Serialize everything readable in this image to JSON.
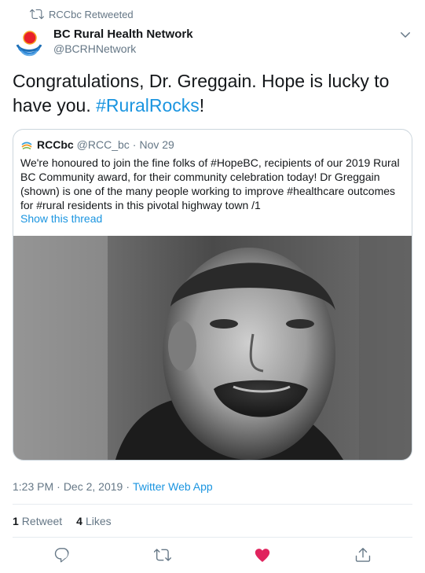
{
  "retweet_context": {
    "text": "RCCbc Retweeted"
  },
  "author": {
    "name": "BC Rural Health Network",
    "handle": "@BCRHNetwork"
  },
  "tweet": {
    "text_before": "Congratulations, Dr. Greggain. Hope is lucky to have you. ",
    "hashtag": "#RuralRocks",
    "text_after": "!"
  },
  "quote": {
    "name": "RCCbc",
    "handle": "@RCC_bc",
    "separator": "·",
    "date": "Nov 29",
    "text": "We're honoured to join the fine folks of #HopeBC, recipients of our 2019 Rural BC Community award, for their community celebration today! Dr Greggain (shown) is one of the many people working to improve #healthcare outcomes for #rural  residents in this pivotal highway town /1",
    "show_thread": "Show this thread"
  },
  "meta": {
    "time": "1:23 PM",
    "date": "Dec 2, 2019",
    "separator": "·",
    "source": "Twitter Web App"
  },
  "stats": {
    "retweets_count": "1",
    "retweets_label": "Retweet",
    "likes_count": "4",
    "likes_label": "Likes"
  },
  "colors": {
    "link": "#1b95e0",
    "secondary": "#657786",
    "liked": "#e0245e"
  },
  "icons": [
    "retweet-icon",
    "chevron-down-icon",
    "reply-icon",
    "retweet-icon",
    "heart-icon",
    "share-icon"
  ]
}
